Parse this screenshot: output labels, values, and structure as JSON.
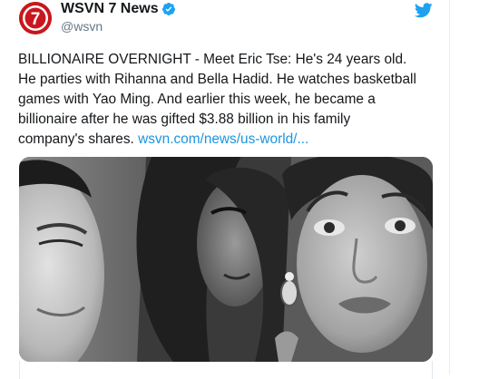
{
  "tweet": {
    "display_name": "WSVN 7 News",
    "handle": "@wsvn",
    "text_line1": "BILLIONAIRE OVERNIGHT - Meet Eric Tse: He's 24 years old.",
    "text_line2": "He parties with Rihanna and Bella Hadid. He watches basketball",
    "text_line3": "games with Yao Ming. And earlier this week, he became a",
    "text_line4": "billionaire after he was gifted $3.88 billion in his family",
    "text_line5_prefix": "company's shares.",
    "link_text": "wsvn.com/news/us-world/...",
    "avatar_label": "7"
  },
  "icons": {
    "verified": "verified-badge-icon",
    "bird": "twitter-bird-icon"
  },
  "colors": {
    "brand_red": "#c8171e",
    "verified_blue": "#1da1f2",
    "link_blue": "#1b95e0",
    "text": "#14171a",
    "muted": "#657786"
  }
}
